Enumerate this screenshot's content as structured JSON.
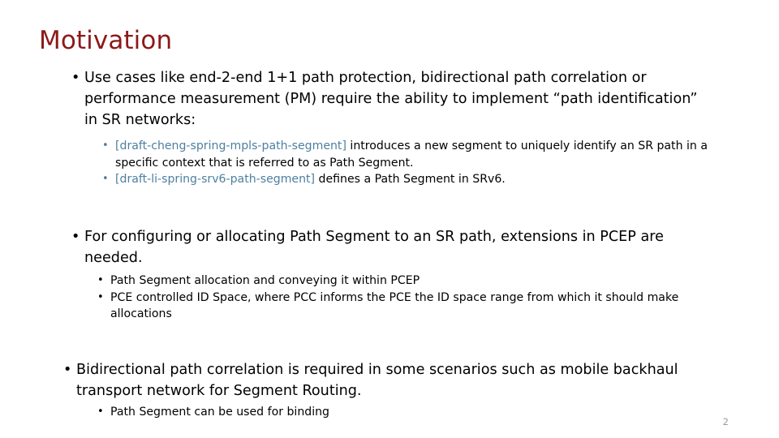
{
  "slide": {
    "title": "Motivation",
    "title_color": "#8B1A1A",
    "link_color": "#4E7FA0",
    "body_color": "#000000",
    "page_number": "2",
    "page_number_color": "#9A9A9A",
    "bullet_glyph": "•",
    "bullets": [
      {
        "level": 1,
        "text": "Use cases like end-2-end 1+1 path protection, bidirectional path correlation or performance measurement (PM) require the ability to implement “path identification” in SR networks:",
        "children": [
          {
            "level": 2,
            "link": "[draft-cheng-spring-mpls-path-segment]",
            "text": " introduces a new segment to uniquely identify an SR path in a specific context that is referred to as Path Segment."
          },
          {
            "level": 2,
            "link": "[draft-li-spring-srv6-path-segment]",
            "text": " defines a Path Segment in SRv6."
          }
        ]
      },
      {
        "level": 1,
        "text": "For configuring or allocating Path Segment to an SR path, extensions in PCEP are needed.",
        "children": [
          {
            "level": 2,
            "link": "",
            "text": "Path Segment allocation and conveying it within PCEP"
          },
          {
            "level": 2,
            "link": "",
            "text": "PCE controlled ID Space, where PCC informs the PCE the ID space range from which it should make allocations"
          }
        ]
      },
      {
        "level": 1,
        "text": "Bidirectional path correlation is required in some scenarios such as mobile backhaul transport network for Segment Routing.",
        "children": [
          {
            "level": 2,
            "link": "",
            "text": "Path Segment can be used for binding"
          }
        ]
      }
    ]
  }
}
